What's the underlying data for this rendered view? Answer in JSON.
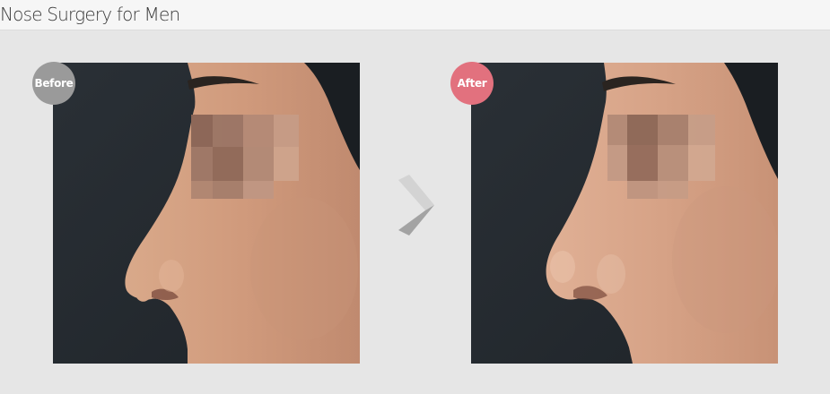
{
  "header": {
    "title": "Nose Surgery for Men"
  },
  "comparison": {
    "before": {
      "badge_label": "Before",
      "badge_color": "#9a9a9a"
    },
    "after": {
      "badge_label": "After",
      "badge_color": "#e2717e"
    },
    "divider_icon": "chevron-right-icon"
  },
  "colors": {
    "background": "#e6e6e6",
    "title_bar": "#f6f6f6",
    "photo_background": "#252a2f",
    "skin": "#d5a487"
  }
}
